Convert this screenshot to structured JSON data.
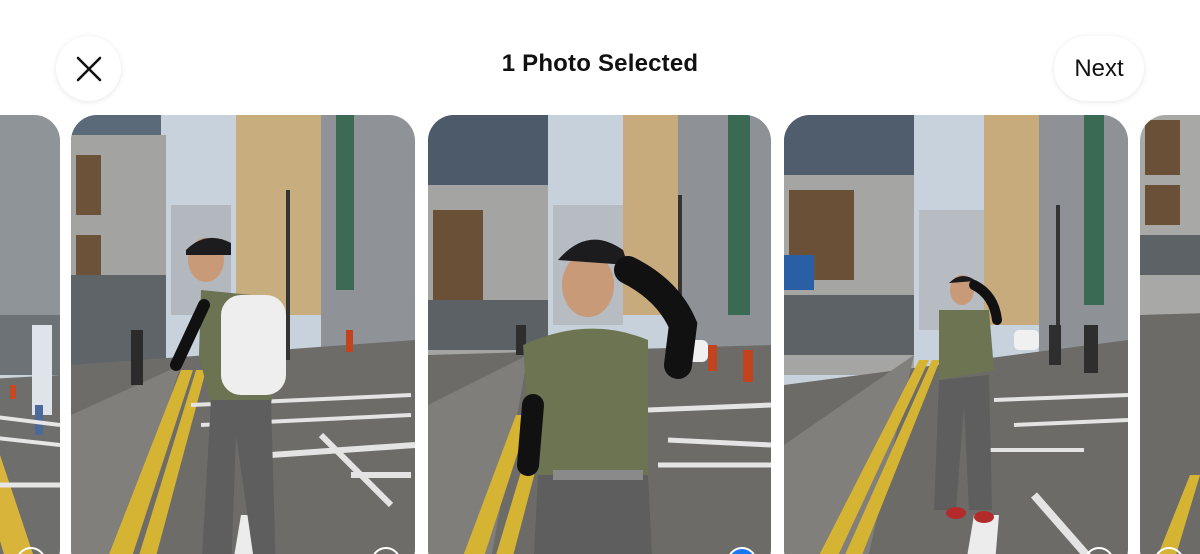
{
  "header": {
    "title": "1 Photo Selected",
    "next_label": "Next"
  },
  "icons": {
    "close": "close-icon",
    "favorite": "heart-icon",
    "selection": "selection-circle-icon",
    "selected": "checkmark-icon"
  },
  "colors": {
    "accent": "#1877f2",
    "background": "#ffffff",
    "text": "#111111"
  },
  "photos": [
    {
      "favorite": false,
      "selected": false
    },
    {
      "favorite": true,
      "selected": false
    },
    {
      "favorite": true,
      "selected": true
    },
    {
      "favorite": true,
      "selected": false
    },
    {
      "favorite": false,
      "selected": false
    }
  ]
}
